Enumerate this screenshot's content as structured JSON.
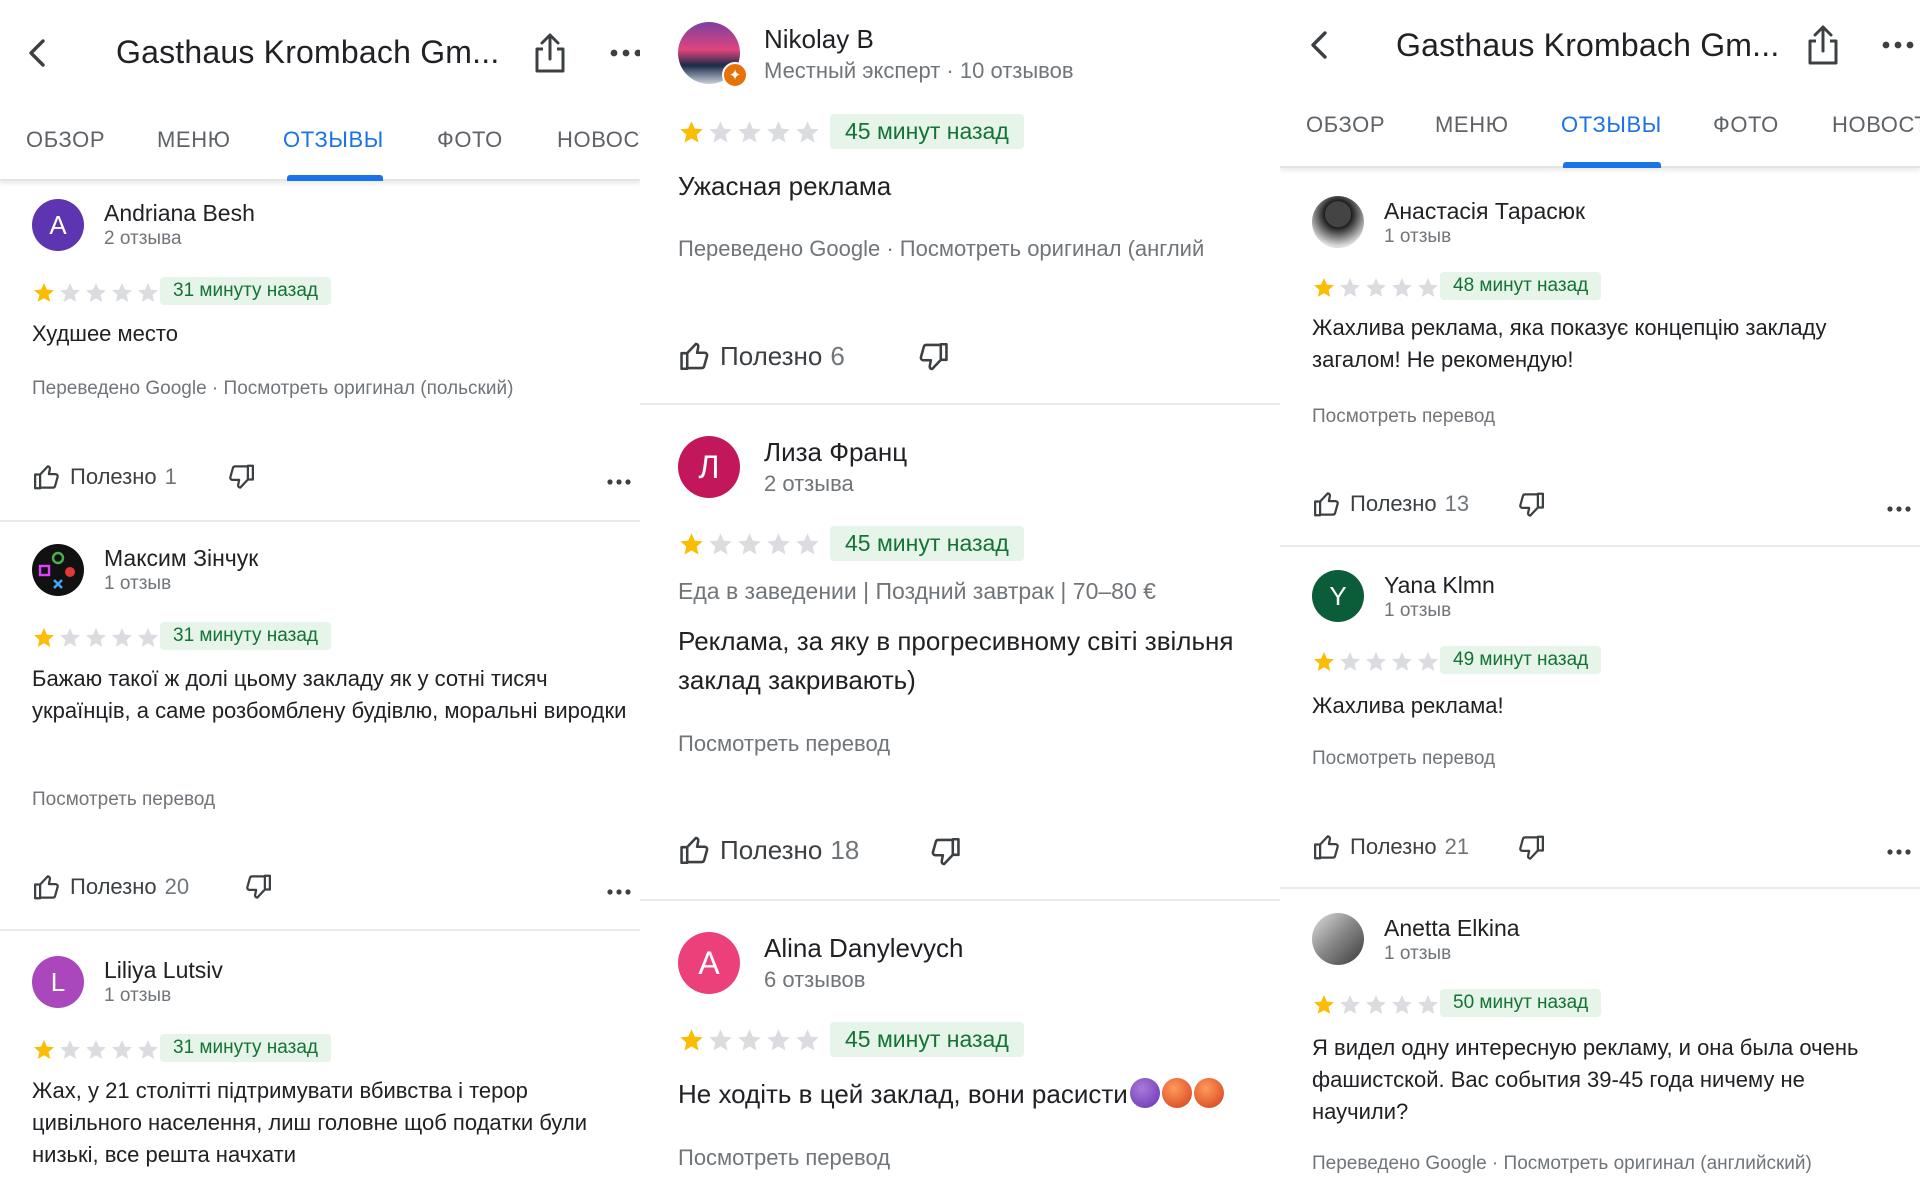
{
  "app": {
    "title": "Gasthaus Krombach Gm...",
    "tabs": [
      "ОБЗОР",
      "МЕНЮ",
      "ОТЗЫВЫ",
      "ФОТО",
      "НОВОСТ"
    ],
    "active_tab": "ОТЗЫВЫ"
  },
  "labels": {
    "helpful": "Полезно",
    "see_translation": "Посмотреть перевод",
    "translated_by": "Переведено Google",
    "see_original_pl": "Посмотреть оригинал (польский)",
    "see_original_en": "Посмотреть оригинал (английский)",
    "see_original_en_cut": "Посмотреть оригинал (англий"
  },
  "colors": {
    "accent": "#1a73e8",
    "star": "#fbbc04",
    "star_empty": "#dadce0",
    "time_bg": "#e6f4ea",
    "time_text": "#137333"
  },
  "column1": {
    "reviews": [
      {
        "initial": "A",
        "author": "Andriana Besh",
        "meta": "2 отзыва",
        "rating": 1,
        "time": "31 минуту назад",
        "text": "Худшее место",
        "helpful_count": "1"
      },
      {
        "initial": "",
        "author": "Максим Зінчук",
        "meta": "1 отзыв",
        "rating": 1,
        "time": "31 минуту назад",
        "text": "Бажаю такої ж долі цьому закладу як у сотні тисяч українців, а саме розбомблену будівлю, моральні виродки",
        "helpful_count": "20"
      },
      {
        "initial": "L",
        "author": "Liliya Lutsiv",
        "meta": "1 отзыв",
        "rating": 1,
        "time": "31 минуту назад",
        "text": "Жах, у 21 столітті підтримувати вбивства і терор цивільного населення, лиш головне щоб  податки були низькі, все решта начхати"
      }
    ]
  },
  "column2": {
    "reviews": [
      {
        "author": "Nikolay B",
        "meta": "Местный эксперт · 10 отзывов",
        "rating": 1,
        "time": "45 минут назад",
        "text": "Ужасная реклама",
        "helpful_count": "6"
      },
      {
        "initial": "Л",
        "author": "Лиза Франц",
        "meta": "2 отзыва",
        "rating": 1,
        "time": "45 минут назад",
        "details": "Еда в заведении  |  Поздний завтрак  |  70–80 €",
        "text": "Реклама, за яку в прогресивному світі звільня заклад закривають)",
        "helpful_count": "18"
      },
      {
        "initial": "A",
        "author": "Alina Danylevych",
        "meta": "6 отзывов",
        "rating": 1,
        "time": "45 минут назад",
        "text": "Не ходіть в цей заклад, вони расисти"
      }
    ]
  },
  "column3": {
    "reviews": [
      {
        "author": "Анастасія Тарасюк",
        "meta": "1 отзыв",
        "rating": 1,
        "time": "48 минут назад",
        "text": "Жахлива реклама, яка показує концепцію закладу загалом! Не рекомендую!",
        "helpful_count": "13"
      },
      {
        "initial": "Y",
        "author": "Yana Klmn",
        "meta": "1 отзыв",
        "rating": 1,
        "time": "49 минут назад",
        "text": "Жахлива реклама!",
        "helpful_count": "21"
      },
      {
        "author": "Anetta Elkina",
        "meta": "1 отзыв",
        "rating": 1,
        "time": "50 минут назад",
        "text": "Я видел одну интересную рекламу, и она была очень фашистской. Вас события 39-45 года ничему не научили?"
      }
    ]
  }
}
